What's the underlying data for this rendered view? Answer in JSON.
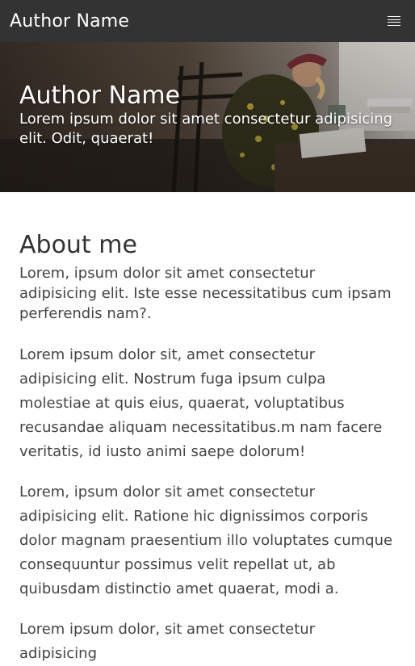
{
  "header": {
    "brand": "Author Name",
    "menu_icon": "hamburger-menu-icon"
  },
  "hero": {
    "title": "Author Name",
    "subtitle": "Lorem ipsum dolor sit amet consectetur adipisicing elit. Odit, quaerat!"
  },
  "about": {
    "title": "About me",
    "lead": "Lorem, ipsum dolor sit amet consectetur adipisicing elit. Iste esse necessitatibus cum ipsam perferendis nam?.",
    "paragraphs": [
      "Lorem ipsum dolor sit, amet consectetur adipisicing elit. Nostrum fuga ipsum culpa molestiae at quis eius, quaerat, voluptatibus recusandae aliquam necessitatibus.m nam facere veritatis, id iusto animi saepe dolorum!",
      "Lorem, ipsum dolor sit amet consectetur adipisicing elit. Ratione hic dignissimos corporis dolor magnam praesentium illo voluptates cumque consequuntur possimus velit repellat ut, ab quibusdam distinctio amet quaerat, modi a.",
      "Lorem ipsum dolor, sit amet consectetur adipisicing"
    ]
  },
  "colors": {
    "header_bg": "#333333",
    "text": "#444444"
  }
}
